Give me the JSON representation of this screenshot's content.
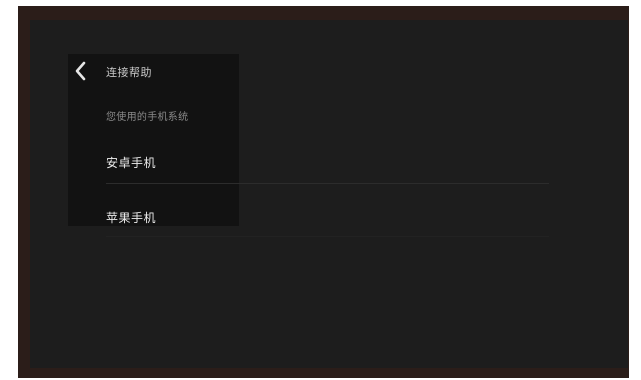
{
  "header": {
    "title": "连接帮助",
    "back_icon": "chevron-left-icon"
  },
  "section": {
    "hint": "您使用的手机系统"
  },
  "options": [
    {
      "label": "安卓手机"
    },
    {
      "label": "苹果手机"
    }
  ],
  "colors": {
    "frame": "#2b1d19",
    "screen": "#1d1d1d",
    "panel": "#121212",
    "text_primary": "#ededed",
    "text_secondary": "#8a8a8a"
  }
}
